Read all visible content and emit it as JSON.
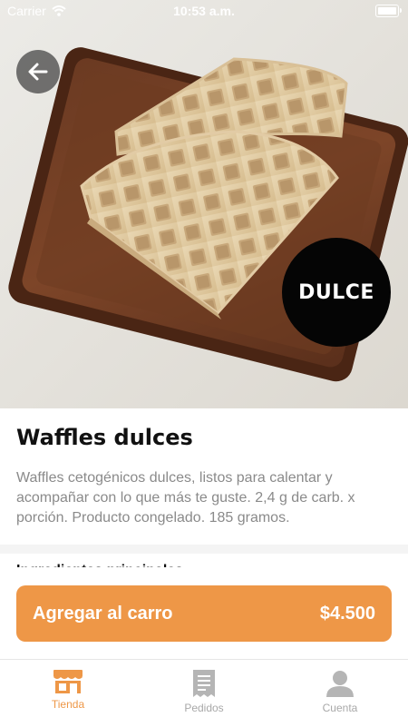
{
  "status_bar": {
    "carrier": "Carrier",
    "time": "10:53 a.m."
  },
  "product": {
    "badge": "DULCE",
    "title": "Waffles dulces",
    "description": "Waffles cetogénicos dulces, listos para calentar y acompañar con lo que más te guste. 2,4 g de carb. x porción. Producto congelado. 185 gramos.",
    "ingredients_heading": "Ingredientes principales"
  },
  "cart": {
    "label": "Agregar al carro",
    "price": "$4.500"
  },
  "tabs": [
    {
      "label": "Tienda",
      "icon": "store-icon",
      "active": true
    },
    {
      "label": "Pedidos",
      "icon": "receipt-icon",
      "active": false
    },
    {
      "label": "Cuenta",
      "icon": "user-icon",
      "active": false
    }
  ],
  "colors": {
    "accent": "#ee9747",
    "inactive": "#a8a8a8",
    "badge_bg": "#050505"
  }
}
